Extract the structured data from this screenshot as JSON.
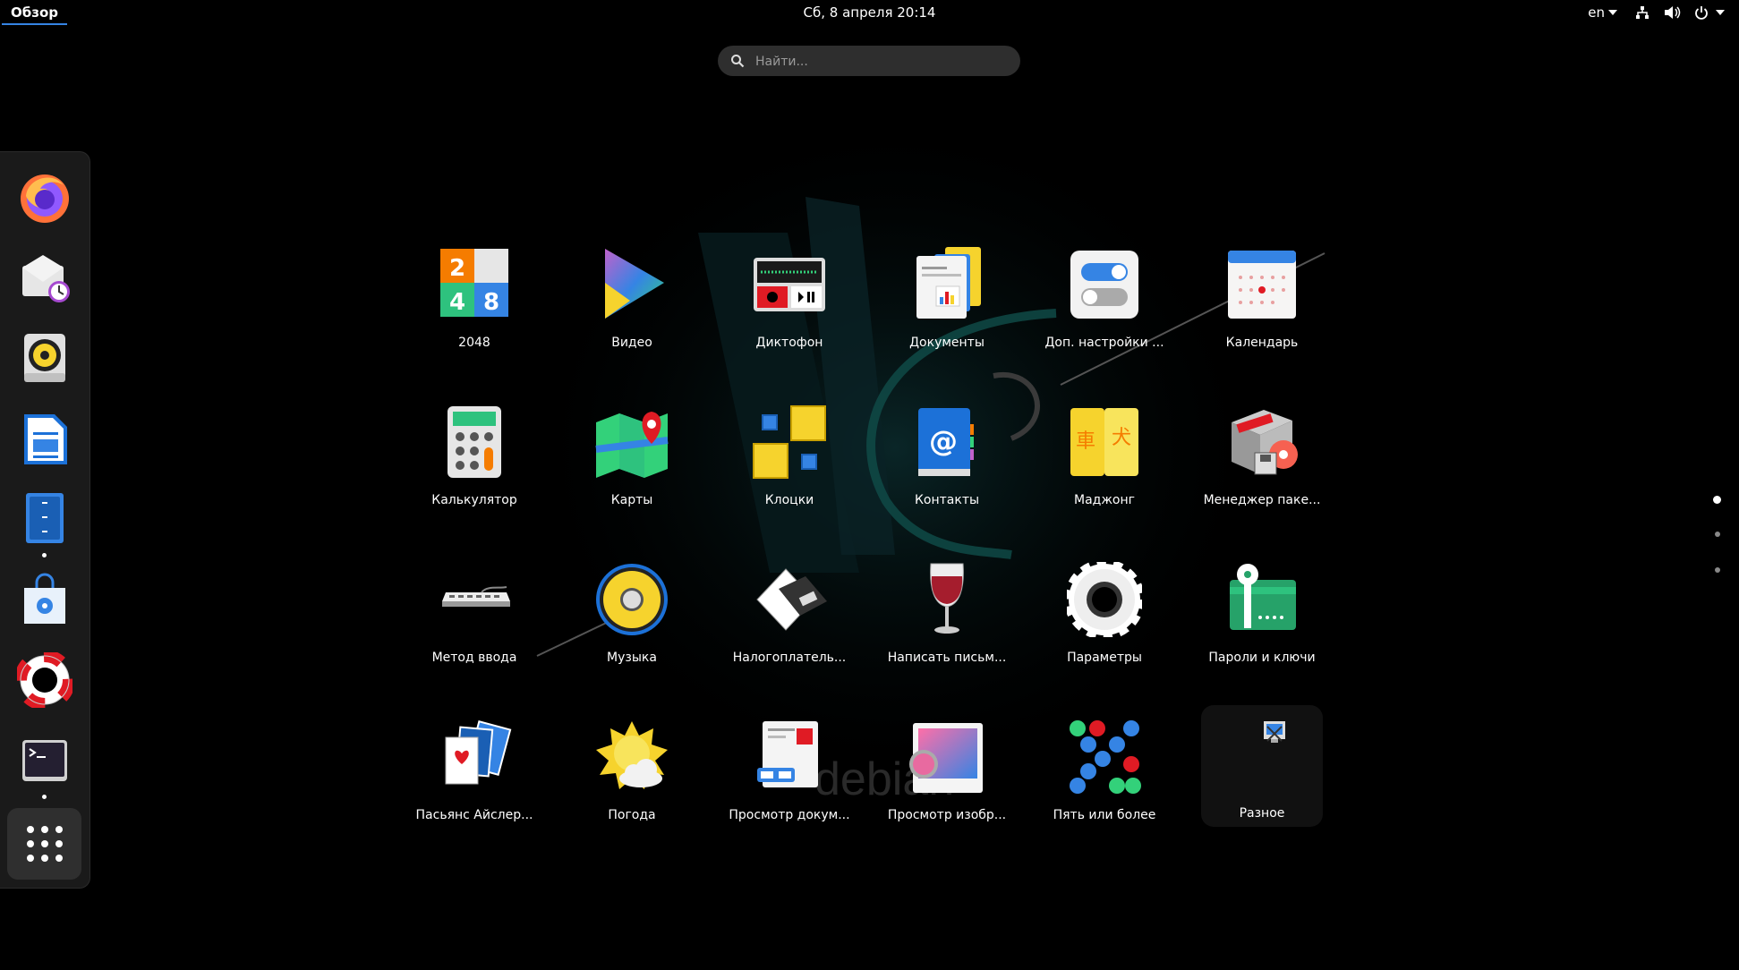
{
  "topbar": {
    "activities": "Обзор",
    "clock": "Сб, 8 апреля  20:14",
    "keyboard_layout": "en"
  },
  "search": {
    "placeholder": "Найти..."
  },
  "dash": {
    "items": [
      {
        "name": "firefox-icon",
        "running": false
      },
      {
        "name": "evolution-mail-icon",
        "running": false
      },
      {
        "name": "rhythmbox-icon",
        "running": false
      },
      {
        "name": "libreoffice-writer-icon",
        "running": false
      },
      {
        "name": "files-icon",
        "running": true
      },
      {
        "name": "software-store-icon",
        "running": false
      },
      {
        "name": "help-lifebuoy-icon",
        "running": false
      },
      {
        "name": "terminal-icon",
        "running": true
      }
    ],
    "show_apps_icon": "grid-icon"
  },
  "apps": [
    {
      "label": "2048",
      "icon": "2048-icon"
    },
    {
      "label": "Видео",
      "icon": "video-icon"
    },
    {
      "label": "Диктофон",
      "icon": "recorder-icon"
    },
    {
      "label": "Документы",
      "icon": "documents-icon"
    },
    {
      "label": "Доп. настройки ...",
      "icon": "tweaks-icon"
    },
    {
      "label": "Календарь",
      "icon": "calendar-icon"
    },
    {
      "label": "Калькулятор",
      "icon": "calculator-icon"
    },
    {
      "label": "Карты",
      "icon": "maps-icon"
    },
    {
      "label": "Клоцки",
      "icon": "klotski-icon"
    },
    {
      "label": "Контакты",
      "icon": "contacts-icon"
    },
    {
      "label": "Маджонг",
      "icon": "mahjongg-icon"
    },
    {
      "label": "Менеджер паке...",
      "icon": "package-manager-icon"
    },
    {
      "label": "Метод ввода",
      "icon": "keyboard-icon"
    },
    {
      "label": "Музыка",
      "icon": "music-icon"
    },
    {
      "label": "Налогоплатель...",
      "icon": "taxpayer-icon"
    },
    {
      "label": "Написать письм...",
      "icon": "wine-icon"
    },
    {
      "label": "Параметры",
      "icon": "settings-gear-icon"
    },
    {
      "label": "Пароли и ключи",
      "icon": "passwords-key-icon"
    },
    {
      "label": "Пасьянс Айслер...",
      "icon": "solitaire-cards-icon"
    },
    {
      "label": "Погода",
      "icon": "weather-icon"
    },
    {
      "label": "Просмотр докум...",
      "icon": "document-viewer-icon"
    },
    {
      "label": "Просмотр изобр...",
      "icon": "image-viewer-icon"
    },
    {
      "label": "Пять или более",
      "icon": "five-or-more-icon"
    },
    {
      "label": "Разное",
      "icon": "folder-misc-icon"
    }
  ],
  "wallpaper_text": "debian",
  "pages": {
    "count": 3,
    "current": 1
  },
  "colors": {
    "accent": "#3584e4",
    "panel": "#000000",
    "dash": "#1a1a1a"
  }
}
